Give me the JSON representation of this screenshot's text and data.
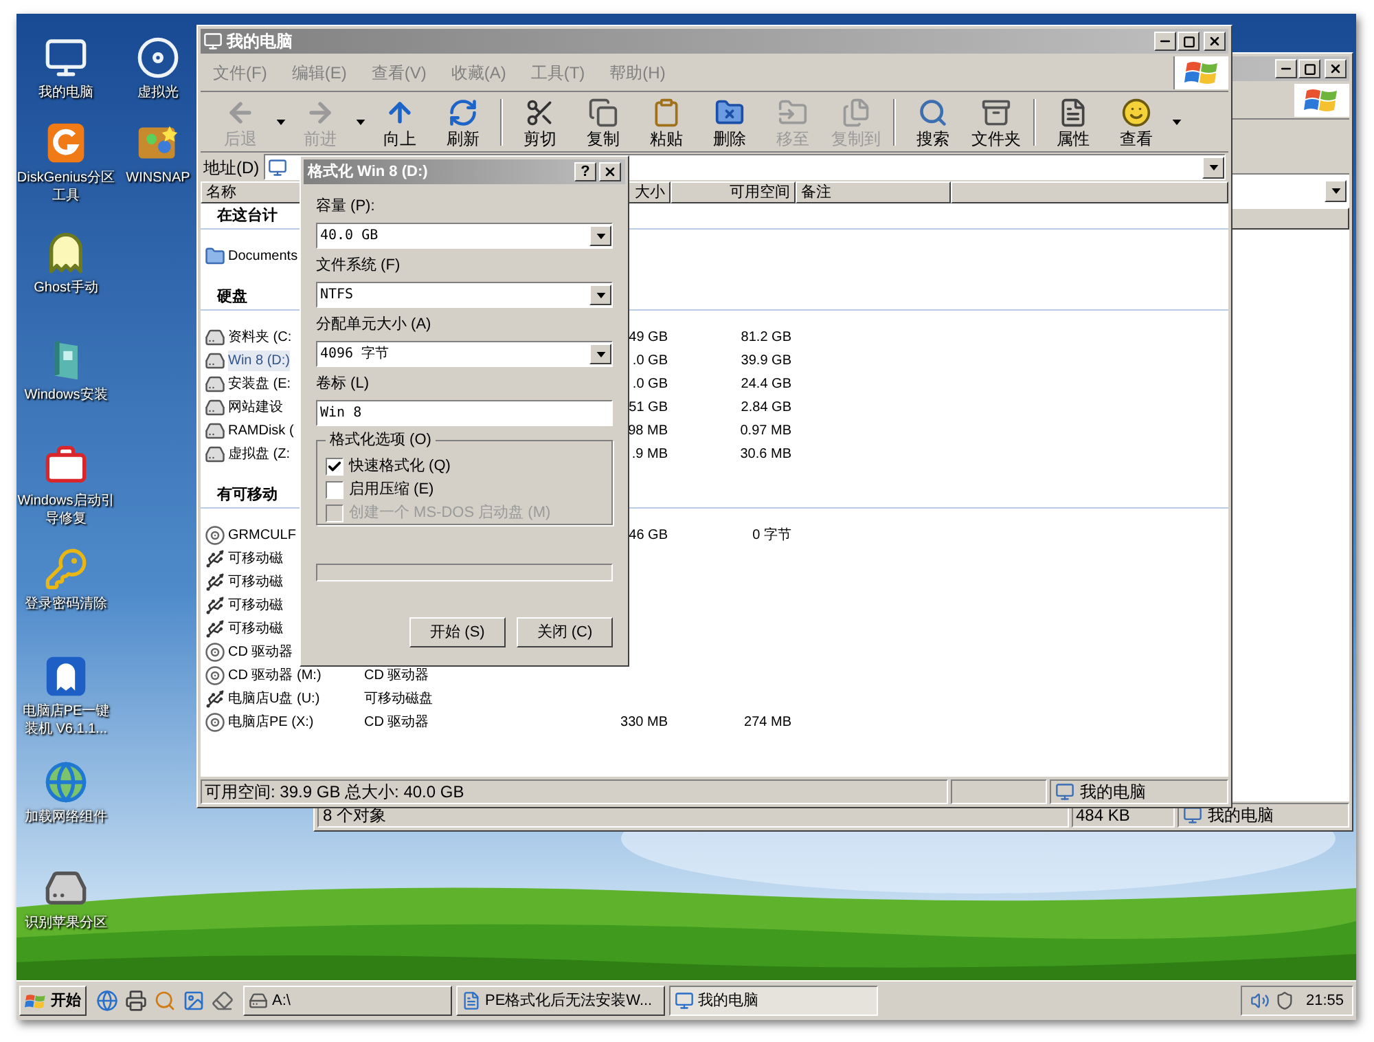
{
  "desktop_columns": [
    [
      {
        "label": "我的电脑",
        "kind": "computer"
      },
      {
        "label": "DiskGenius分区工具",
        "kind": "partition-tool"
      },
      {
        "label": "Ghost手动",
        "kind": "ghost"
      },
      {
        "label": "Windows安装",
        "kind": "installer"
      },
      {
        "label": "Windows启动引导修复",
        "kind": "repair"
      },
      {
        "label": "登录密码清除",
        "kind": "key"
      },
      {
        "label": "电脑店PE一键装机 V6.1.1...",
        "kind": "pe"
      },
      {
        "label": "加载网络组件",
        "kind": "network"
      },
      {
        "label": "识别苹果分区",
        "kind": "drive"
      }
    ],
    [
      {
        "label": "虚拟光",
        "kind": "disc"
      },
      {
        "label": "WINSNAP",
        "kind": "screenshot"
      }
    ]
  ],
  "background_window": {
    "object_count": "8 个对象",
    "size": "484 KB",
    "location": "我的电脑"
  },
  "main_window": {
    "title": "我的电脑",
    "menu": [
      "文件(F)",
      "编辑(E)",
      "查看(V)",
      "收藏(A)",
      "工具(T)",
      "帮助(H)"
    ],
    "toolbar": [
      {
        "label": "后退",
        "kind": "back",
        "disabled": true,
        "dropdown": true,
        "separator_after": false
      },
      {
        "label": "前进",
        "kind": "forward",
        "disabled": true,
        "dropdown": true,
        "separator_after": false
      },
      {
        "label": "向上",
        "kind": "up",
        "disabled": false,
        "dropdown": false,
        "separator_after": false
      },
      {
        "label": "刷新",
        "kind": "refresh",
        "disabled": false,
        "dropdown": false,
        "separator_after": true
      },
      {
        "label": "剪切",
        "kind": "cut",
        "disabled": false,
        "dropdown": false,
        "separator_after": false
      },
      {
        "label": "复制",
        "kind": "copy",
        "disabled": false,
        "dropdown": false,
        "separator_after": false
      },
      {
        "label": "粘贴",
        "kind": "paste",
        "disabled": false,
        "dropdown": false,
        "separator_after": false
      },
      {
        "label": "删除",
        "kind": "delete",
        "disabled": false,
        "dropdown": false,
        "separator_after": false
      },
      {
        "label": "移至",
        "kind": "move",
        "disabled": true,
        "dropdown": false,
        "separator_after": false
      },
      {
        "label": "复制到",
        "kind": "copyto",
        "disabled": true,
        "dropdown": false,
        "separator_after": true
      },
      {
        "label": "搜索",
        "kind": "search",
        "disabled": false,
        "dropdown": false,
        "separator_after": false
      },
      {
        "label": "文件夹",
        "kind": "folders",
        "disabled": false,
        "dropdown": false,
        "separator_after": true
      },
      {
        "label": "属性",
        "kind": "properties",
        "disabled": false,
        "dropdown": false,
        "separator_after": false
      },
      {
        "label": "查看",
        "kind": "view",
        "disabled": false,
        "dropdown": true,
        "separator_after": false
      }
    ],
    "address_label": "地址(D)",
    "columns": {
      "name": "名称",
      "total": "大小",
      "free": "可用空间",
      "note": "备注"
    },
    "rows": [
      {
        "kind": "group",
        "name": "在这台计"
      },
      {
        "kind": "folder",
        "name": "Documents",
        "selected": false
      },
      {
        "kind": "group",
        "name": "硬盘"
      },
      {
        "kind": "hdd",
        "name": "资料夹 (C:",
        "total": "49 GB",
        "free": "81.2 GB",
        "selected": false
      },
      {
        "kind": "hdd",
        "name": "Win 8 (D:)",
        "total": ".0 GB",
        "free": "39.9 GB",
        "selected": true
      },
      {
        "kind": "hdd",
        "name": "安装盘 (E:",
        "total": ".0 GB",
        "free": "24.4 GB",
        "selected": false
      },
      {
        "kind": "hdd",
        "name": "网站建设",
        "total": "51 GB",
        "free": "2.84 GB",
        "selected": false
      },
      {
        "kind": "hdd",
        "name": "RAMDisk (",
        "total": "98 MB",
        "free": "0.97 MB",
        "selected": false
      },
      {
        "kind": "hdd",
        "name": "虚拟盘 (Z:",
        "total": ".9 MB",
        "free": "30.6 MB",
        "selected": false
      },
      {
        "kind": "group",
        "name": "有可移动"
      },
      {
        "kind": "cd",
        "name": "GRMCULF",
        "total": "46 GB",
        "free": "0 字节",
        "selected": false
      },
      {
        "kind": "removable",
        "name": "可移动磁",
        "selected": false
      },
      {
        "kind": "removable",
        "name": "可移动磁",
        "selected": false
      },
      {
        "kind": "removable",
        "name": "可移动磁",
        "selected": false
      },
      {
        "kind": "removable",
        "name": "可移动磁",
        "selected": false
      },
      {
        "kind": "cd",
        "name": "CD 驱动器",
        "selected": false
      },
      {
        "kind": "cd",
        "name": "CD 驱动器 (M:)",
        "type": "CD 驱动器",
        "selected": false
      },
      {
        "kind": "removable",
        "name": "电脑店U盘 (U:)",
        "type": "可移动磁盘",
        "selected": false
      },
      {
        "kind": "cd",
        "name": "电脑店PE (X:)",
        "type": "CD 驱动器",
        "total": "330 MB",
        "free": "274 MB",
        "selected": false
      }
    ],
    "status": "可用空间: 39.9 GB 总大小: 40.0 GB",
    "status_location": "我的电脑"
  },
  "dialog": {
    "title": "格式化 Win 8 (D:)",
    "help": "?",
    "fields": [
      {
        "kind": "select",
        "label": "容量 (P):",
        "value": "40.0 GB"
      },
      {
        "kind": "select",
        "label": "文件系统 (F)",
        "value": "NTFS"
      },
      {
        "kind": "select",
        "label": "分配单元大小 (A)",
        "value": "4096 字节"
      },
      {
        "kind": "text",
        "label": "卷标 (L)",
        "value": "Win 8"
      }
    ],
    "options_title": "格式化选项 (O)",
    "options": [
      {
        "label": "快速格式化 (Q)",
        "checked": true,
        "disabled": false
      },
      {
        "label": "启用压缩 (E)",
        "checked": false,
        "disabled": false
      },
      {
        "label": "创建一个 MS-DOS 启动盘 (M)",
        "checked": false,
        "disabled": true
      }
    ],
    "progress": {
      "level": 0
    },
    "buttons": [
      "开始 (S)",
      "关闭 (C)"
    ]
  },
  "taskbar": {
    "start": "开始",
    "tasks": [
      {
        "label": "A:\\",
        "kind": "drive",
        "selected": false
      },
      {
        "label": "PE格式化后无法安装W...",
        "kind": "document",
        "selected": false
      },
      {
        "label": "我的电脑",
        "kind": "computer",
        "selected": true
      }
    ],
    "clock": "21:55"
  }
}
